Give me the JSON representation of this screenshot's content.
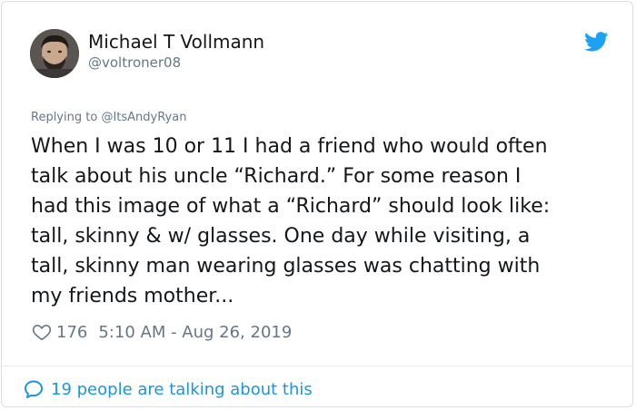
{
  "author": {
    "name": "Michael T Vollmann",
    "handle": "@voltroner08"
  },
  "icons": {
    "brand": "twitter-bird-icon",
    "like": "heart-icon",
    "conversation": "speech-bubble-icon"
  },
  "colors": {
    "brand_blue": "#1da1f2",
    "link_blue": "#1b95e0",
    "text_primary": "#14171a",
    "text_secondary": "#657786",
    "border": "#d9dfe4"
  },
  "reply": {
    "prefix": "Replying to ",
    "handle": "@ItsAndyRyan"
  },
  "tweet": {
    "text": "When I was 10 or 11 I had a friend who would often\ntalk about his uncle “Richard.” For some reason I\nhad this image of what a “Richard” should look like:\ntall, skinny & w/ glasses. One day while visiting,  a\ntall, skinny man wearing glasses was chatting with\nmy friends mother..."
  },
  "meta": {
    "likes": "176",
    "timestamp": "5:10 AM - Aug 26, 2019"
  },
  "footer": {
    "conversation_label": "19 people are talking about this"
  }
}
